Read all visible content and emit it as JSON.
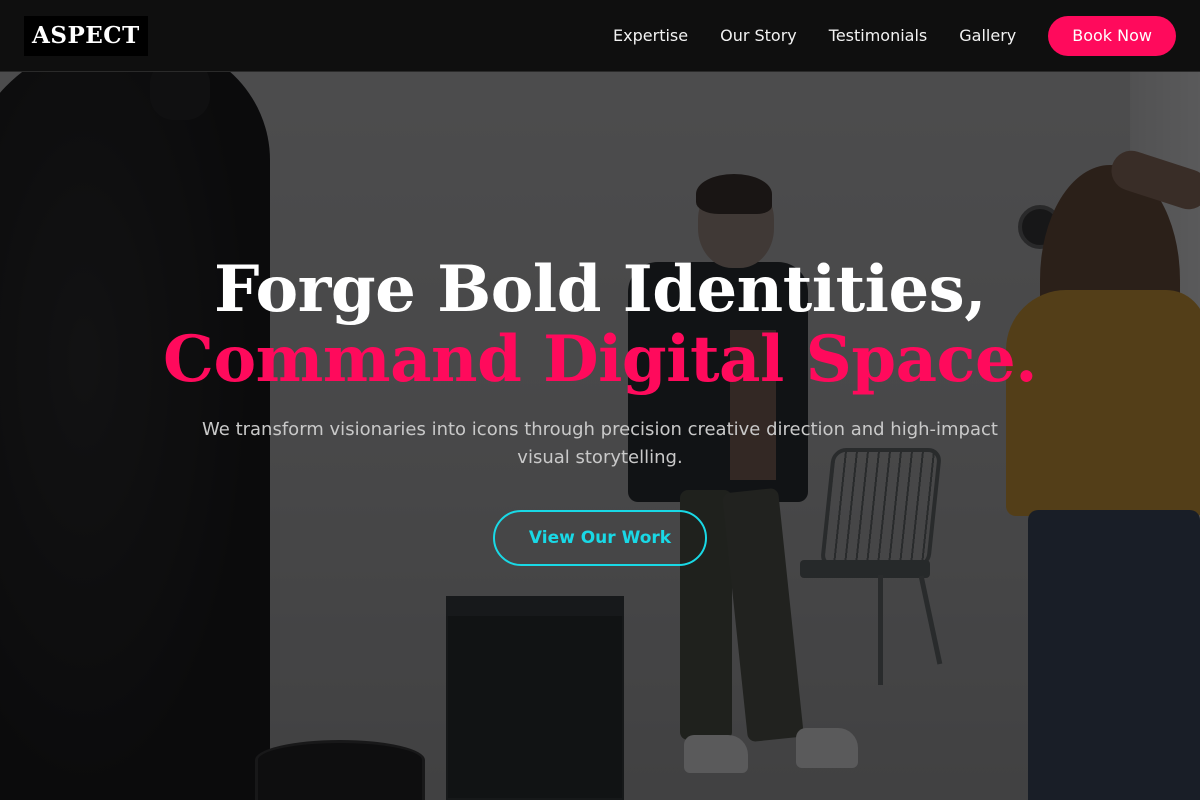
{
  "brand": {
    "logo_text": "ASPECT"
  },
  "nav": {
    "links": [
      "Expertise",
      "Our Story",
      "Testimonials",
      "Gallery"
    ],
    "cta_label": "Book Now"
  },
  "hero": {
    "headline_line1": "Forge Bold Identities,",
    "headline_line2": "Command Digital Space.",
    "subtitle": "We transform visionaries into icons through precision creative direction and high-impact visual storytelling.",
    "cta_label": "View Our Work"
  },
  "colors": {
    "accent_pink": "#ff0a5c",
    "accent_cyan": "#19d9e6",
    "nav_background": "#0f0f0f"
  }
}
